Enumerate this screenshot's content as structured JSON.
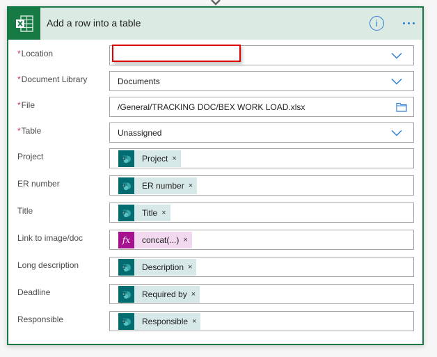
{
  "card": {
    "title": "Add a row into a table",
    "app_icon": "excel-icon",
    "info_icon": "info-icon",
    "more_icon": "more-options-icon",
    "info_glyph": "i",
    "accent_color": "#177944",
    "header_bg": "#dbeae2"
  },
  "required_marker": "*",
  "fields": [
    {
      "label": "Location",
      "required": true,
      "type": "dropdown",
      "value": "",
      "highlighted": true
    },
    {
      "label": "Document Library",
      "required": true,
      "type": "dropdown",
      "value": "Documents"
    },
    {
      "label": "File",
      "required": true,
      "type": "file-picker",
      "value": "/General/TRACKING DOC/BEX WORK LOAD.xlsx"
    },
    {
      "label": "Table",
      "required": true,
      "type": "dropdown",
      "value": "Unassigned"
    },
    {
      "label": "Project",
      "required": false,
      "type": "token",
      "token": {
        "label": "Project",
        "source": "sharepoint-icon"
      }
    },
    {
      "label": "ER number",
      "required": false,
      "type": "token",
      "token": {
        "label": "ER number",
        "source": "sharepoint-icon"
      }
    },
    {
      "label": "Title",
      "required": false,
      "type": "token",
      "token": {
        "label": "Title",
        "source": "sharepoint-icon"
      }
    },
    {
      "label": "Link to image/doc",
      "required": false,
      "type": "token",
      "token": {
        "label": "concat(...)",
        "source": "function-icon",
        "glyph": "fx"
      }
    },
    {
      "label": "Long description",
      "required": false,
      "type": "token",
      "token": {
        "label": "Description",
        "source": "sharepoint-icon"
      }
    },
    {
      "label": "Deadline",
      "required": false,
      "type": "token",
      "token": {
        "label": "Required by",
        "source": "sharepoint-icon"
      }
    },
    {
      "label": "Responsible",
      "required": false,
      "type": "token",
      "token": {
        "label": "Responsible",
        "source": "sharepoint-icon"
      }
    }
  ],
  "token_close_glyph": "×",
  "colors": {
    "sharepoint_token_bg": "#d7e8e8",
    "sharepoint_icon_bg": "#036c70",
    "function_token_bg": "#f2d9f0",
    "function_icon_bg": "#a5118e",
    "link_blue": "#2f7fd5",
    "highlight_red": "#e00000"
  }
}
